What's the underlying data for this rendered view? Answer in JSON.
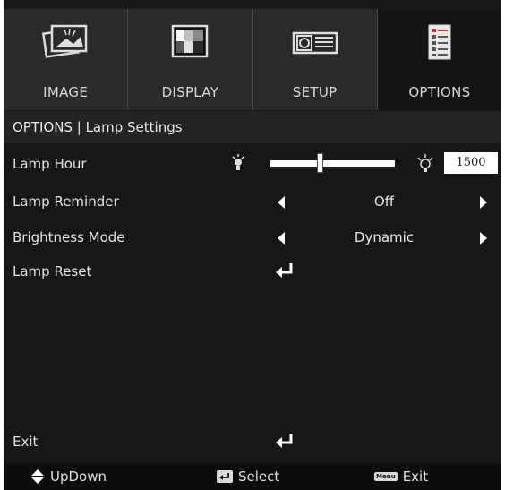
{
  "tabs": [
    {
      "label": "IMAGE",
      "icon": "image-icon",
      "active": false
    },
    {
      "label": "DISPLAY",
      "icon": "display-icon",
      "active": false
    },
    {
      "label": "SETUP",
      "icon": "projector-icon",
      "active": false
    },
    {
      "label": "OPTIONS",
      "icon": "options-list-icon",
      "active": true
    }
  ],
  "breadcrumb": "OPTIONS | Lamp Settings",
  "rows": {
    "lamp_hour": {
      "label": "Lamp Hour",
      "value": "1500",
      "slider_fraction": 0.4
    },
    "lamp_reminder": {
      "label": "Lamp Reminder",
      "value": "Off"
    },
    "brightness_mode": {
      "label": "Brightness Mode",
      "value": "Dynamic"
    },
    "lamp_reset": {
      "label": "Lamp Reset"
    },
    "exit": {
      "label": "Exit"
    }
  },
  "footer": {
    "updown": "UpDown",
    "select": "Select",
    "menu_key": "Menu",
    "exit": "Exit"
  },
  "colors": {
    "background": "#171717",
    "tab_bg": "#2a2a2a",
    "active_tab_bg": "#141414",
    "accent": "#ffffff"
  }
}
